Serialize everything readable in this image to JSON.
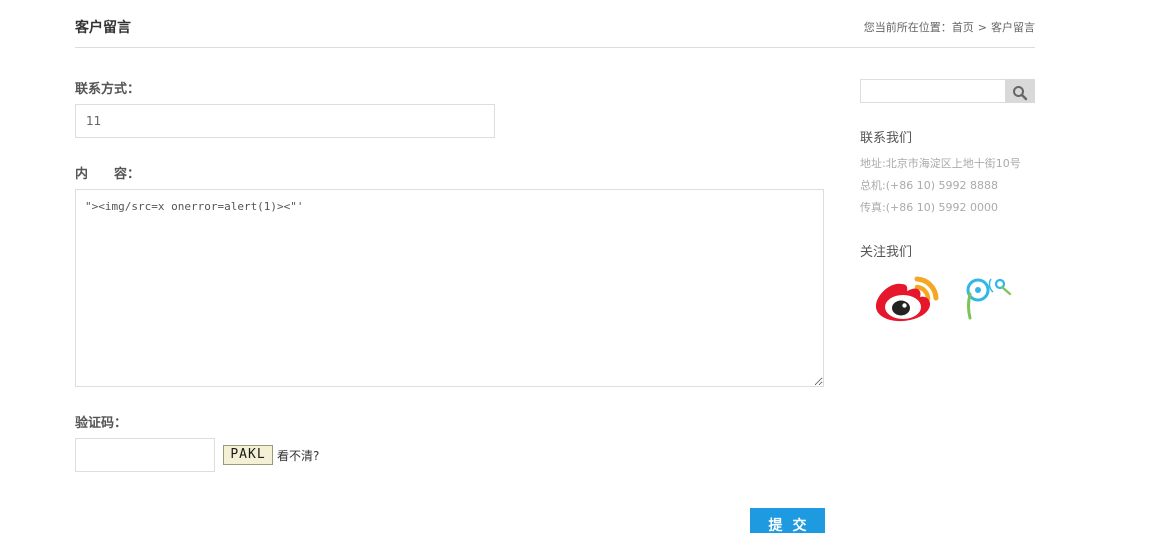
{
  "header": {
    "title": "客户留言",
    "breadcrumb_prefix": "您当前所在位置：",
    "breadcrumb_home": "首页",
    "breadcrumb_sep": ">",
    "breadcrumb_current": "客户留言"
  },
  "form": {
    "contact_label": "联系方式：",
    "contact_value": "11",
    "content_label_a": "内",
    "content_label_b": "容：",
    "content_value": "\"><img/src=x onerror=alert(1)><\"'",
    "captcha_label": "验证码：",
    "captcha_value": "",
    "captcha_code": "PAKL",
    "captcha_refresh": "看不清?",
    "submit_label": "提交"
  },
  "sidebar": {
    "search_placeholder": "",
    "contact_heading": "联系我们",
    "address": "地址:北京市海淀区上地十街10号",
    "phone": "总机:(+86 10) 5992 8888",
    "fax": "传真:(+86 10) 5992 0000",
    "follow_heading": "关注我们",
    "icons": [
      "weibo-icon",
      "location-pin-icon"
    ]
  },
  "colors": {
    "accent": "#1e9ae0",
    "weibo_red": "#e6162d",
    "weibo_orange": "#f5a623",
    "pin_blue": "#2fb7e6",
    "pin_green": "#7cc35a"
  }
}
